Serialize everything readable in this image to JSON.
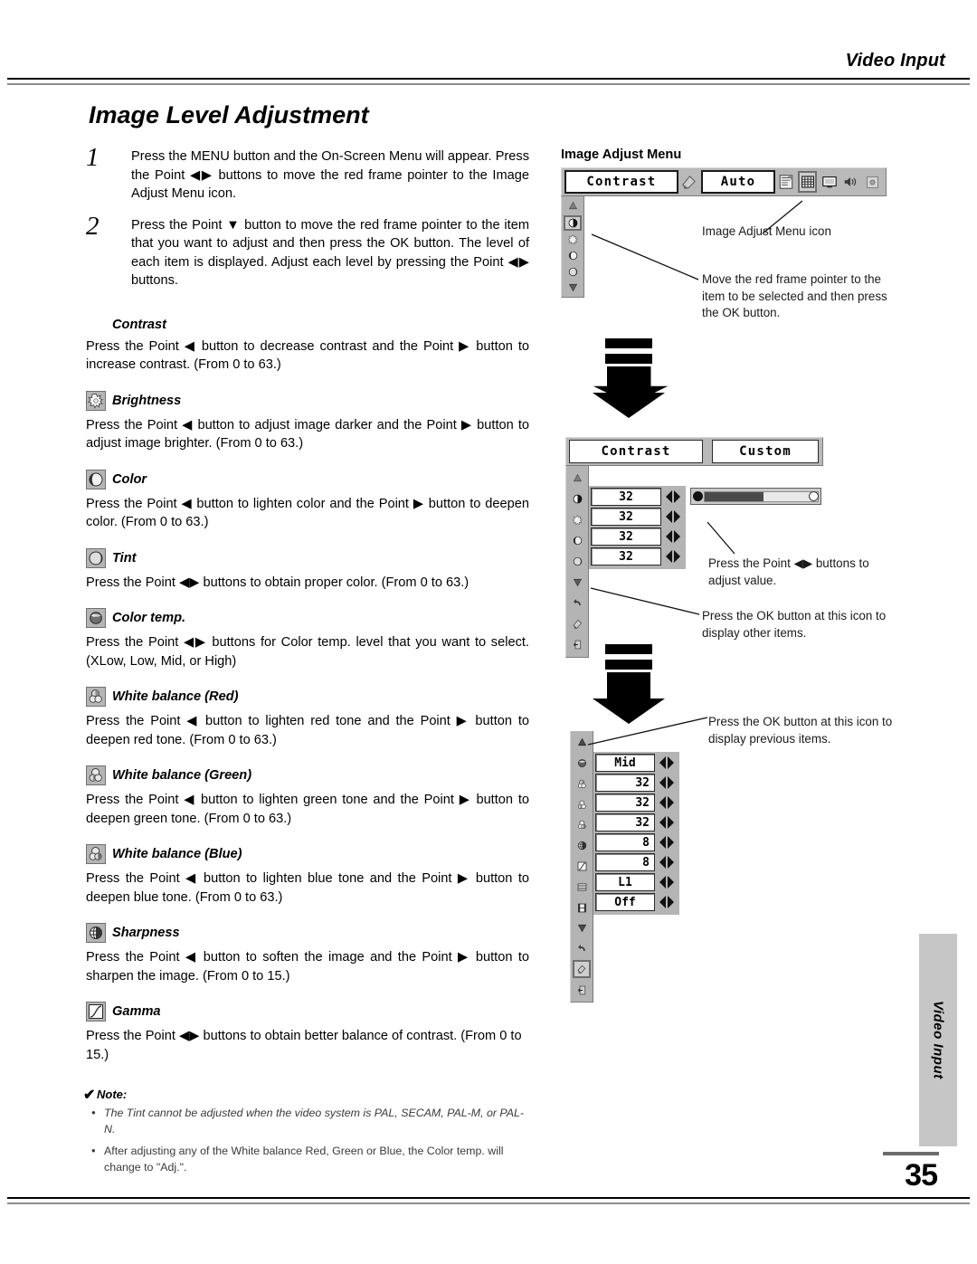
{
  "header": {
    "section_label": "Video Input",
    "title": "Image Level Adjustment"
  },
  "steps": [
    {
      "number": "1",
      "text": "Press the MENU button and the On-Screen Menu will appear.  Press the Point ◀▶ buttons to move the red frame pointer to the Image Adjust Menu icon."
    },
    {
      "number": "2",
      "text": "Press the Point ▼ button to move the red frame pointer to the item that you want to adjust and then press the OK button.  The level of each item is displayed.  Adjust each level by pressing the Point ◀▶ buttons."
    }
  ],
  "sections": [
    {
      "icon": "contrast-icon",
      "has_icon": false,
      "title": "Contrast",
      "body": "Press the Point ◀ button to decrease contrast and the Point ▶ button to increase contrast.  (From 0 to 63.)"
    },
    {
      "icon": "brightness-icon",
      "has_icon": true,
      "title": "Brightness",
      "body": "Press the Point ◀ button to adjust image darker and the Point ▶ button to adjust image brighter.  (From 0 to 63.)"
    },
    {
      "icon": "color-icon",
      "has_icon": true,
      "title": "Color",
      "body": "Press the Point ◀ button to lighten color and the Point ▶ button to deepen color.  (From 0 to 63.)"
    },
    {
      "icon": "tint-icon",
      "has_icon": true,
      "title": "Tint",
      "body": "Press the Point ◀▶ buttons to obtain proper color.  (From 0 to 63.)"
    },
    {
      "icon": "color-temp-icon",
      "has_icon": true,
      "title": "Color temp.",
      "body": "Press the Point ◀▶ buttons for Color temp. level that you want to select. (XLow, Low, Mid, or High)"
    },
    {
      "icon": "white-balance-red-icon",
      "has_icon": true,
      "title": "White balance (Red)",
      "body": "Press the Point ◀ button to lighten red tone and the Point ▶ button to deepen red tone.  (From 0 to 63.)"
    },
    {
      "icon": "white-balance-green-icon",
      "has_icon": true,
      "title": "White balance (Green)",
      "body": "Press the Point ◀ button to lighten green tone and the Point ▶ button to deepen green tone.  (From 0 to 63.)"
    },
    {
      "icon": "white-balance-blue-icon",
      "has_icon": true,
      "title": "White balance (Blue)",
      "body": "Press the Point ◀ button to lighten blue tone and the Point ▶ button to deepen blue tone.  (From 0 to 63.)"
    },
    {
      "icon": "sharpness-icon",
      "has_icon": true,
      "title": "Sharpness",
      "body": "Press the Point ◀ button to soften the image and the Point ▶ button to sharpen the image.  (From 0 to 15.)"
    },
    {
      "icon": "gamma-icon",
      "has_icon": true,
      "title": "Gamma",
      "body": "Press the Point ◀▶ buttons to obtain better balance of contrast. (From 0 to 15.)"
    }
  ],
  "note": {
    "check": "✔",
    "title": "Note:",
    "items": [
      "The Tint cannot be adjusted when the video system is PAL, SECAM, PAL-M, or PAL-N.",
      "After adjusting any of the White balance Red, Green or Blue, the Color temp. will change to \"Adj.\"."
    ]
  },
  "osd": {
    "panel1": {
      "caption": "Image Adjust Menu",
      "menu_label": "Contrast",
      "mode_value": "Auto",
      "bar_icons": [
        "image-select-icon",
        "image-adjust-icon",
        "screen-icon",
        "sound-icon",
        "setting-icon"
      ],
      "selected_bar_icon": "image-adjust-icon",
      "side_icons": [
        "scroll-up-icon",
        "contrast-icon",
        "brightness-icon",
        "color-icon",
        "tint-icon",
        "scroll-down-icon"
      ],
      "selected_side_icon": "contrast-icon",
      "callouts": [
        "Image Adjust Menu icon",
        "Move the red frame pointer to the item to be selected and then press the OK button."
      ]
    },
    "panel2": {
      "menu_label": "Contrast",
      "mode_value": "Custom",
      "side_icons": [
        "scroll-up-icon",
        "contrast-icon",
        "brightness-icon",
        "color-icon",
        "tint-icon",
        "scroll-down-icon",
        "reset-icon",
        "store-icon",
        "quit-icon"
      ],
      "values": [
        "32",
        "32",
        "32",
        "32"
      ],
      "slider_percent": 52,
      "callouts": [
        "Press the Point ◀▶ buttons to adjust value.",
        "Press the OK button at this icon to display other items."
      ]
    },
    "panel3": {
      "side_icons": [
        "scroll-up-icon",
        "color-temp-icon",
        "white-balance-red-icon",
        "white-balance-green-icon",
        "white-balance-blue-icon",
        "sharpness-icon",
        "gamma-icon",
        "noise-reduction-icon",
        "progressive-icon",
        "scroll-down-icon",
        "reset-icon",
        "store-icon",
        "quit-icon"
      ],
      "selected_side_icon": "store-icon",
      "rows": [
        {
          "icon": "color-temp-icon",
          "value": "Mid",
          "align": "center"
        },
        {
          "icon": "white-balance-red-icon",
          "value": "32",
          "align": "right"
        },
        {
          "icon": "white-balance-green-icon",
          "value": "32",
          "align": "right"
        },
        {
          "icon": "white-balance-blue-icon",
          "value": "32",
          "align": "right"
        },
        {
          "icon": "sharpness-icon",
          "value": "8",
          "align": "right"
        },
        {
          "icon": "gamma-icon",
          "value": "8",
          "align": "right"
        },
        {
          "icon": "noise-reduction-icon",
          "value": "L1",
          "align": "center"
        },
        {
          "icon": "progressive-icon",
          "value": "Off",
          "align": "center"
        }
      ],
      "callouts": [
        "Press the OK button at this icon to display previous items."
      ]
    }
  },
  "footer": {
    "page_number": "35",
    "side_tab": "Video Input"
  },
  "colors": {
    "osd_gray": "#b9b9b9",
    "osd_side_gray": "#b4b4b4",
    "sidetab_gray": "#c6c6c6",
    "rule_gray": "#8d8d8d"
  }
}
